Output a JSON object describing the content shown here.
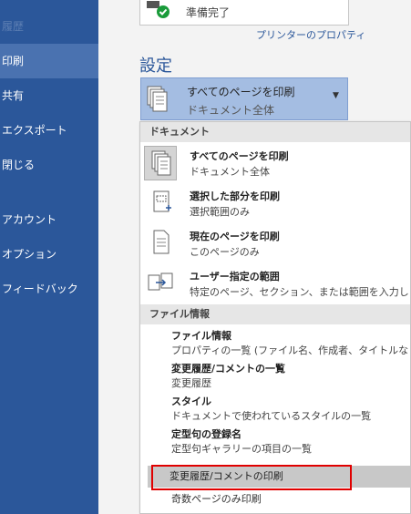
{
  "nav": {
    "items": [
      {
        "label": "履歴",
        "faded": true
      },
      {
        "label": "印刷",
        "active": true
      },
      {
        "label": "共有"
      },
      {
        "label": "エクスポート"
      },
      {
        "label": "閉じる"
      },
      {
        "label": "アカウント"
      },
      {
        "label": "オプション"
      },
      {
        "label": "フィードバック"
      }
    ]
  },
  "printer": {
    "status": "準備完了",
    "properties_link": "プリンターのプロパティ"
  },
  "settings": {
    "title": "設定",
    "selected": {
      "title": "すべてのページを印刷",
      "subtitle": "ドキュメント全体"
    }
  },
  "menu": {
    "document_header": "ドキュメント",
    "options": [
      {
        "title": "すべてのページを印刷",
        "desc": "ドキュメント全体",
        "icon": "all-pages-icon",
        "selected": true
      },
      {
        "title": "選択した部分を印刷",
        "desc": "選択範囲のみ",
        "icon": "selection-icon"
      },
      {
        "title": "現在のページを印刷",
        "desc": "このページのみ",
        "icon": "current-page-icon"
      },
      {
        "title": "ユーザー指定の範囲",
        "desc": "特定のページ、セクション、または範囲を入力します",
        "icon": "custom-range-icon"
      }
    ],
    "info_header": "ファイル情報",
    "info_items": [
      {
        "title": "ファイル情報",
        "desc": "プロパティの一覧 (ファイル名、作成者、タイトルなど)"
      },
      {
        "title": "変更履歴/コメントの一覧",
        "desc": "変更履歴"
      },
      {
        "title": "スタイル",
        "desc": "ドキュメントで使われているスタイルの一覧"
      },
      {
        "title": "定型句の登録名",
        "desc": "定型句ギャラリーの項目の一覧"
      }
    ],
    "highlighted_item": "変更履歴/コメントの印刷",
    "after_item": "奇数ページのみ印刷"
  },
  "colors": {
    "nav_bg": "#2b579a",
    "accent": "#2b579a",
    "dropdown_bg": "#a4bde2",
    "highlight_border": "#e00000"
  }
}
